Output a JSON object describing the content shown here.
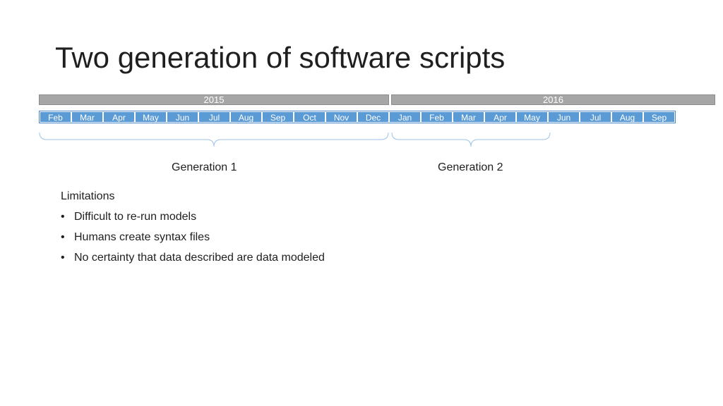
{
  "title": "Two generation of software scripts",
  "timeline": {
    "years": [
      "2015",
      "2016"
    ],
    "months": [
      "Feb",
      "Mar",
      "Apr",
      "May",
      "Jun",
      "Jul",
      "Aug",
      "Sep",
      "Oct",
      "Nov",
      "Dec",
      "Jan",
      "Feb",
      "Mar",
      "Apr",
      "May",
      "Jun",
      "Jul",
      "Aug",
      "Sep"
    ],
    "generations": [
      "Generation 1",
      "Generation 2"
    ]
  },
  "limitations": {
    "heading": "Limitations",
    "items": [
      "Difficult to re-run models",
      "Humans create syntax files",
      "No certainty that data described are data modeled"
    ]
  },
  "colors": {
    "month_fill": "#5b9bd5",
    "year_fill": "#a6a6a6",
    "brace": "#9dc3e6"
  }
}
